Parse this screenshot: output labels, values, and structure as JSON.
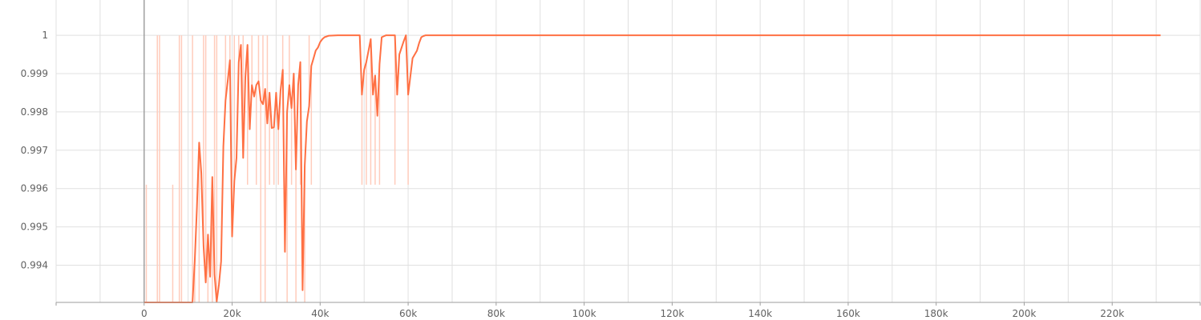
{
  "chart_data": {
    "type": "line",
    "title": "",
    "xlabel": "",
    "ylabel": "",
    "xlim": [
      -20000,
      240000
    ],
    "ylim": [
      0.99303,
      1.00092
    ],
    "grid": true,
    "colors": {
      "smoothed": "#ff7043",
      "raw": "#ffccbc"
    },
    "x_ticks": [
      0,
      20000,
      40000,
      60000,
      80000,
      100000,
      120000,
      140000,
      160000,
      180000,
      200000,
      220000
    ],
    "x_tick_labels": [
      "0",
      "20k",
      "40k",
      "60k",
      "80k",
      "100k",
      "120k",
      "140k",
      "160k",
      "180k",
      "200k",
      "220k"
    ],
    "y_ticks": [
      0.994,
      0.995,
      0.996,
      0.997,
      0.998,
      0.999,
      1.0,
      1.001
    ],
    "y_tick_labels": [
      "0.994",
      "0.995",
      "0.996",
      "0.997",
      "0.998",
      "0.999",
      "1",
      "1"
    ],
    "series": [
      {
        "role": "smoothed",
        "x": [
          0,
          11000,
          11500,
          12000,
          12500,
          13000,
          13500,
          14000,
          14500,
          15000,
          15500,
          16000,
          16500,
          17000,
          17500,
          18000,
          18500,
          19000,
          19500,
          20000,
          20500,
          21000,
          21500,
          22000,
          22500,
          23000,
          23500,
          24000,
          24500,
          25000,
          25500,
          26000,
          26500,
          27000,
          27500,
          28000,
          28500,
          29000,
          29500,
          30000,
          30500,
          31000,
          31500,
          32000,
          32500,
          33000,
          33500,
          34000,
          34500,
          35000,
          35500,
          36000,
          36500,
          37000,
          37500,
          38000,
          38500,
          39000,
          39500,
          40000,
          40500,
          41000,
          42000,
          44000,
          49000,
          49500,
          50000,
          50500,
          51000,
          51500,
          52000,
          52500,
          53000,
          53500,
          54000,
          55000,
          57000,
          57500,
          58000,
          59000,
          59500,
          60000,
          61000,
          62000,
          62500,
          63000,
          63500,
          64000,
          65000,
          100000,
          150000,
          200000,
          231000
        ],
        "y": [
          0.99303,
          0.99303,
          0.9941,
          0.9955,
          0.9972,
          0.9964,
          0.9945,
          0.99355,
          0.9948,
          0.9937,
          0.9963,
          0.99375,
          0.99305,
          0.9935,
          0.9941,
          0.9971,
          0.9983,
          0.9988,
          0.99935,
          0.99475,
          0.9962,
          0.9968,
          0.9993,
          0.99975,
          0.9968,
          0.9989,
          0.99975,
          0.99755,
          0.9987,
          0.9984,
          0.9987,
          0.9988,
          0.9983,
          0.9982,
          0.9986,
          0.9977,
          0.9985,
          0.99758,
          0.9976,
          0.9985,
          0.99755,
          0.99855,
          0.9991,
          0.99435,
          0.998,
          0.9987,
          0.9981,
          0.999,
          0.9965,
          0.9987,
          0.9993,
          0.99335,
          0.9966,
          0.99775,
          0.99815,
          0.9992,
          0.9994,
          0.9996,
          0.99968,
          0.99982,
          0.9999,
          0.99995,
          0.99999,
          1.0,
          1.0,
          0.99845,
          0.9991,
          0.9993,
          0.9996,
          0.9999,
          0.99845,
          0.99895,
          0.9979,
          0.99925,
          0.99995,
          1.0,
          1.0,
          0.99845,
          0.9995,
          0.99985,
          1.0,
          0.99845,
          0.9994,
          0.9996,
          0.9998,
          0.99995,
          0.99998,
          1.0,
          1.0,
          1.0,
          1.0,
          1.0,
          1.0
        ]
      },
      {
        "role": "raw",
        "x": [
          500,
          2500,
          3000,
          3500,
          4500,
          5500,
          6500,
          7500,
          8000,
          8500,
          9500,
          10500,
          11000,
          11500,
          12500,
          13500,
          14000,
          14500,
          15500,
          16000,
          16500,
          18500,
          19500,
          20500,
          21500,
          22500,
          23500,
          24500,
          25500,
          26000,
          26500,
          27000,
          27500,
          28000,
          28500,
          29500,
          30500,
          31500,
          32500,
          33000,
          33500,
          34500,
          35500,
          36500,
          37500,
          38000,
          49500,
          50500,
          51500,
          52500,
          53500,
          57000,
          60000
        ],
        "y": [
          0.9961,
          0.99303,
          1.0,
          1.0,
          0.99303,
          0.99303,
          0.9961,
          0.99303,
          1.0,
          1.0,
          0.99303,
          0.99303,
          1.0,
          0.99303,
          0.99303,
          1.0,
          1.0,
          0.99303,
          0.99303,
          1.0,
          1.0,
          1.0,
          1.0,
          1.0,
          1.0,
          1.0,
          0.9961,
          1.0,
          0.9961,
          1.0,
          0.99303,
          1.0,
          0.99303,
          1.0,
          0.9961,
          0.9961,
          0.9961,
          1.0,
          0.99303,
          1.0,
          0.9961,
          0.99303,
          0.9961,
          0.99303,
          1.0,
          0.9961,
          0.9961,
          0.9961,
          0.9961,
          0.9961,
          0.9961,
          0.9961,
          0.9961
        ]
      }
    ]
  }
}
